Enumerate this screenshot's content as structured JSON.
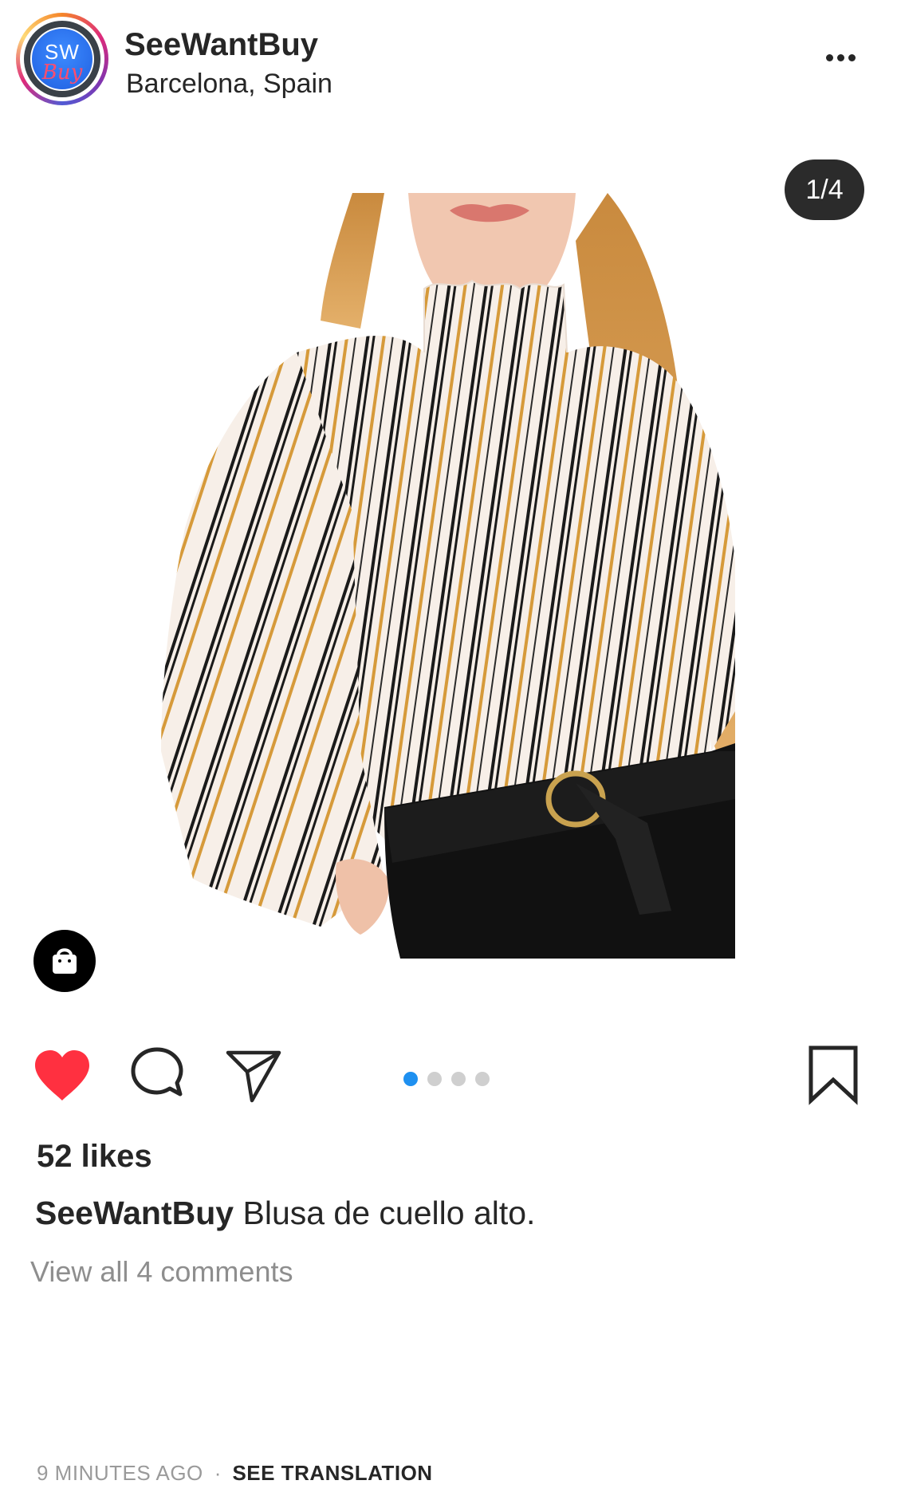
{
  "header": {
    "avatar_text_top": "SW",
    "avatar_text_bottom": "Buy",
    "username": "SeeWantBuy",
    "location": "Barcelona, Spain"
  },
  "media": {
    "counter": "1/4",
    "carousel_current": 1,
    "carousel_total": 4,
    "image_subject": "woman wearing white striped ruffle high-neck blouse with black belted jeans"
  },
  "actions": {
    "liked": true,
    "like_color": "#ff3040",
    "active_dot_color": "#1e90f0"
  },
  "post": {
    "likes": "52 likes",
    "caption_user": "SeeWantBuy",
    "caption_text": " Blusa de cuello alto.",
    "view_comments": "View all 4 comments",
    "timestamp": "9 MINUTES AGO",
    "separator": "·",
    "see_translation": "SEE TRANSLATION"
  },
  "icons": [
    "more-icon",
    "shopping-bag-icon",
    "heart-icon",
    "comment-icon",
    "share-icon",
    "bookmark-icon"
  ]
}
